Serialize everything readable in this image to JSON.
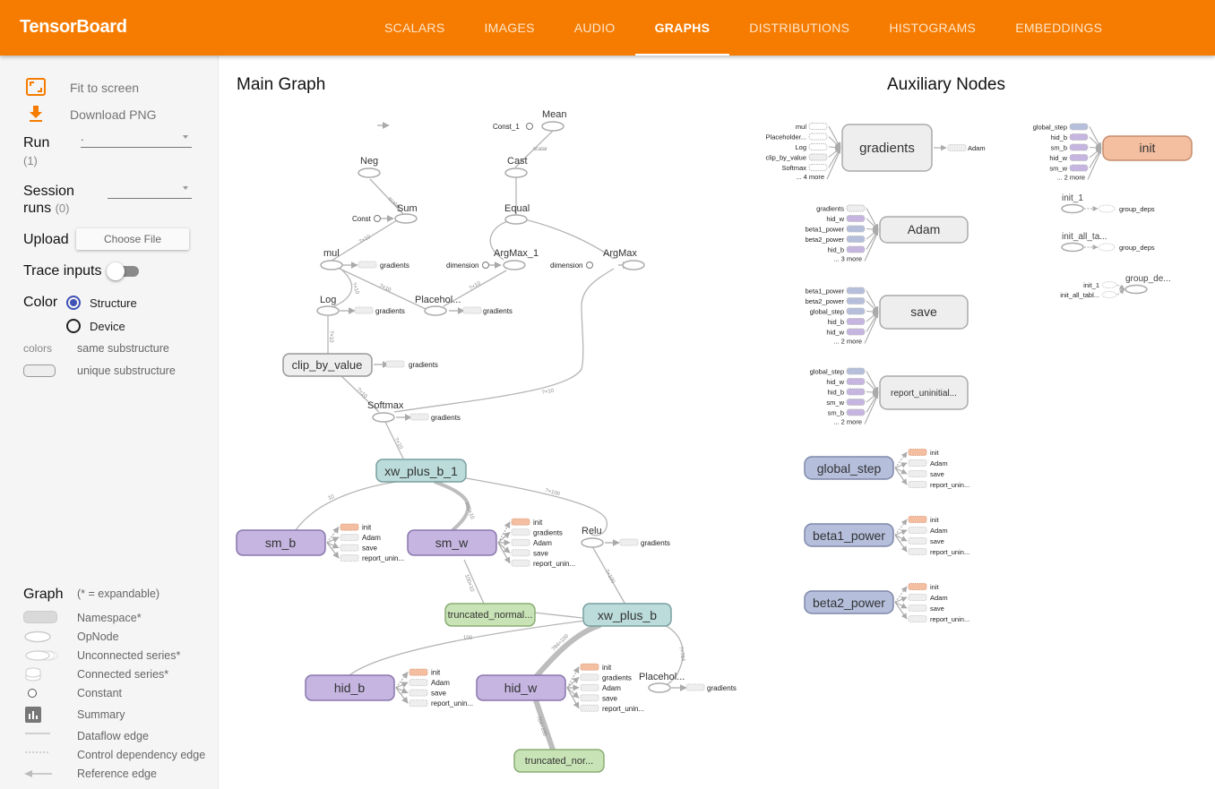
{
  "app": {
    "title": "TensorBoard",
    "accent": "#f57c00"
  },
  "tabs": [
    {
      "label": "SCALARS",
      "active": false
    },
    {
      "label": "IMAGES",
      "active": false
    },
    {
      "label": "AUDIO",
      "active": false
    },
    {
      "label": "GRAPHS",
      "active": true
    },
    {
      "label": "DISTRIBUTIONS",
      "active": false
    },
    {
      "label": "HISTOGRAMS",
      "active": false
    },
    {
      "label": "EMBEDDINGS",
      "active": false
    }
  ],
  "sidebar": {
    "fit_to_screen": "Fit to screen",
    "download_png": "Download PNG",
    "run_label": "Run",
    "run_count": "(1)",
    "run_value": ".",
    "session_label_1": "Session",
    "session_label_2": "runs",
    "session_count": "(0)",
    "session_value": "",
    "upload_label": "Upload",
    "choose_file": "Choose File",
    "trace_inputs": "Trace inputs",
    "trace_inputs_on": false,
    "color_label": "Color",
    "color_options": [
      "Structure",
      "Device"
    ],
    "color_selected": "Structure",
    "colors_label": "colors",
    "same_substructure": "same substructure",
    "unique_substructure": "unique substructure",
    "legend": {
      "title": "Graph",
      "note": "(* = expandable)",
      "items": [
        "Namespace*",
        "OpNode",
        "Unconnected series*",
        "Connected series*",
        "Constant",
        "Summary",
        "Dataflow edge",
        "Control dependency edge",
        "Reference edge"
      ]
    }
  },
  "main_graph": {
    "title": "Main Graph",
    "ops": {
      "mean": "Mean",
      "const_1": "Const_1",
      "cast": "Cast",
      "equal": "Equal",
      "neg": "Neg",
      "sum": "Sum",
      "const": "Const",
      "mul": "mul",
      "argmax_1": "ArgMax_1",
      "argmax": "ArgMax",
      "dimension": "dimension",
      "log": "Log",
      "placeholder_1": "Placehol...",
      "softmax": "Softmax",
      "relu": "Relu",
      "placeholder_2": "Placehol..."
    },
    "namespaces": {
      "clip_by_value": "clip_by_value",
      "xw_plus_b_1": "xw_plus_b_1",
      "xw_plus_b": "xw_plus_b",
      "sm_b": "sm_b",
      "sm_w": "sm_w",
      "hid_b": "hid_b",
      "hid_w": "hid_w",
      "truncated_normal_1": "truncated_normal...",
      "truncated_normal_2": "truncated_nor..."
    },
    "aux_labels": {
      "gradients": "gradients",
      "init": "init",
      "adam": "Adam",
      "save": "save",
      "report": "report_unin..."
    },
    "edge_labels": {
      "e_softmax_xw1": "?×10",
      "e_xw1_smb": "10",
      "e_xw1_smw": "100×10",
      "e_xw1_relu": "?×100",
      "e_relu_xw": "?×100",
      "e_xw_hidb": "100",
      "e_xw_hidw": "784×100",
      "e_hidw_trunc": "784×100",
      "e_smw_trunc": "100×10",
      "e_xw_ph": "?×784",
      "e_sum_mul": "?×10",
      "e_neg_sum": "scalar",
      "e_mul_log": "?×10",
      "e_mul_ph": "?×10",
      "e_log_clip": "?×10",
      "e_clip_softmax": "?×10",
      "e_argmax1_ph": "?×10",
      "e_argmax_softmax": "?×10"
    }
  },
  "aux_graph": {
    "title": "Auxiliary Nodes",
    "gradients": {
      "label": "gradients",
      "inputs": [
        "mul",
        "Placeholder...",
        "Log",
        "clip_by_value",
        "Softmax"
      ],
      "more": "... 4 more",
      "output": "Adam"
    },
    "adam": {
      "label": "Adam",
      "inputs": [
        "gradients",
        "hid_w",
        "beta1_power",
        "beta2_power",
        "hid_b"
      ],
      "more": "... 3 more"
    },
    "save": {
      "label": "save",
      "inputs": [
        "beta1_power",
        "beta2_power",
        "global_step",
        "hid_b",
        "hid_w"
      ],
      "more": "... 2 more"
    },
    "report": {
      "label": "report_uninitial...",
      "inputs": [
        "global_step",
        "hid_w",
        "hid_b",
        "sm_w",
        "sm_b"
      ],
      "more": "... 2 more"
    },
    "init": {
      "label": "init",
      "inputs": [
        "global_step",
        "hid_b",
        "sm_b",
        "hid_w",
        "sm_w"
      ],
      "more": "... 2 more"
    },
    "init_1": {
      "label": "init_1",
      "output": "group_deps"
    },
    "init_all_tables": {
      "label": "init_all_ta...",
      "output": "group_deps"
    },
    "group_deps": {
      "label": "group_de...",
      "inputs": [
        "init_1",
        "init_all_tabl..."
      ]
    },
    "variables": [
      {
        "label": "global_step",
        "outputs": [
          "init",
          "Adam",
          "save",
          "report_unin..."
        ]
      },
      {
        "label": "beta1_power",
        "outputs": [
          "init",
          "Adam",
          "save",
          "report_unin..."
        ]
      },
      {
        "label": "beta2_power",
        "outputs": [
          "init",
          "Adam",
          "save",
          "report_unin..."
        ]
      }
    ]
  },
  "colors": {
    "namespace_gray": "#eeeeee",
    "variable_purple": "#c5b5e0",
    "xw_teal": "#bcdcdc",
    "trunc_green": "#c8e3b6",
    "init_orange": "#f4bea0",
    "aux_blue": "#b5bfdc"
  }
}
